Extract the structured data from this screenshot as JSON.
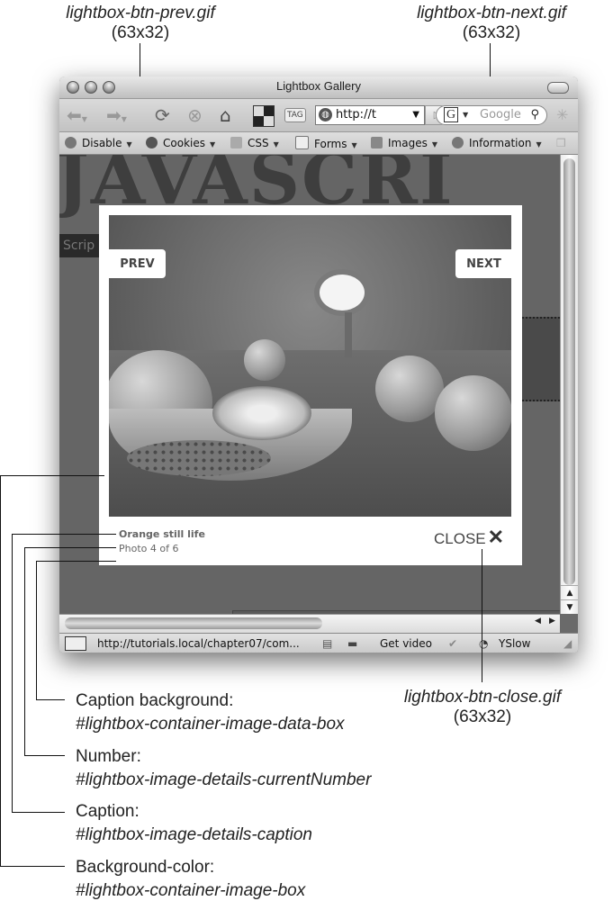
{
  "callouts": {
    "prev": {
      "filename": "lightbox-btn-prev.gif",
      "size": "(63x32)"
    },
    "next": {
      "filename": "lightbox-btn-next.gif",
      "size": "(63x32)"
    },
    "close": {
      "filename": "lightbox-btn-close.gif",
      "size": "(63x32)"
    },
    "caption_bg": {
      "label": "Caption background:",
      "selector": "#lightbox-container-image-data-box"
    },
    "number": {
      "label": "Number:",
      "selector": "#lightbox-image-details-currentNumber"
    },
    "caption": {
      "label": "Caption:",
      "selector": "#lightbox-image-details-caption"
    },
    "bgcolor": {
      "label": "Background-color:",
      "selector": "#lightbox-container-image-box"
    }
  },
  "window": {
    "title": "Lightbox Gallery",
    "address": "http://t",
    "search_placeholder": "Google",
    "search_engine_glyph": "G",
    "devbar": [
      "Disable",
      "Cookies",
      "CSS",
      "Forms",
      "Images",
      "Information"
    ],
    "status_url": "http://tutorials.local/chapter07/com...",
    "status_items": [
      "Get video",
      "YSlow"
    ]
  },
  "page": {
    "banner": "JAVASCRI",
    "nav_fragment": "Scrip"
  },
  "lightbox": {
    "prev_label": "PREV",
    "next_label": "NEXT",
    "close_label": "CLOSE",
    "close_glyph": "✕",
    "caption": "Orange still life",
    "number": "Photo 4 of 6"
  }
}
